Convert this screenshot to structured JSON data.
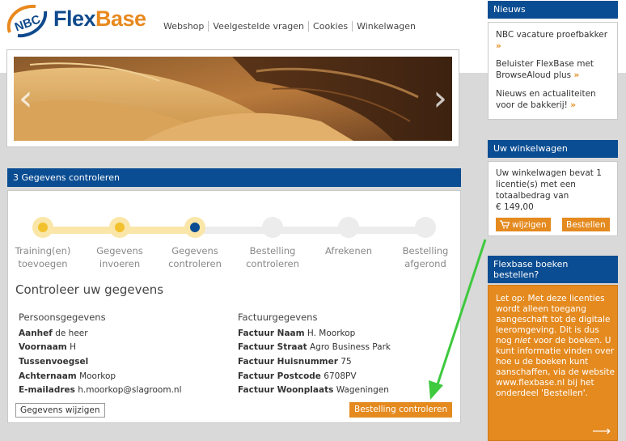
{
  "logo": {
    "badge": "NBC",
    "flex": "Flex",
    "base": "Base"
  },
  "nav": [
    "Webshop",
    "Veelgestelde vragen",
    "Cookies",
    "Winkelwagen"
  ],
  "banner": {
    "prev": "‹",
    "next": "›"
  },
  "section": {
    "title": "3 Gegevens controleren"
  },
  "steps": [
    {
      "line1": "Training(en)",
      "line2": "toevoegen",
      "state": "done"
    },
    {
      "line1": "Gegevens",
      "line2": "invoeren",
      "state": "done"
    },
    {
      "line1": "Gegevens",
      "line2": "controleren",
      "state": "current"
    },
    {
      "line1": "Bestelling",
      "line2": "controleren",
      "state": "todo"
    },
    {
      "line1": "Afrekenen",
      "line2": "",
      "state": "todo"
    },
    {
      "line1": "Bestelling",
      "line2": "afgerond",
      "state": "todo"
    }
  ],
  "check": {
    "heading": "Controleer uw gegevens",
    "personal_title": "Persoonsgegevens",
    "personal": [
      {
        "label": "Aanhef",
        "value": "de heer"
      },
      {
        "label": "Voornaam",
        "value": "H"
      },
      {
        "label": "Tussenvoegsel",
        "value": ""
      },
      {
        "label": "Achternaam",
        "value": "Moorkop"
      },
      {
        "label": "E-mailadres",
        "value": "h.moorkop@slagroom.nl"
      }
    ],
    "invoice_title": "Factuurgegevens",
    "invoice": [
      {
        "label": "Factuur Naam",
        "value": "H. Moorkop"
      },
      {
        "label": "Factuur Straat",
        "value": "Agro Business Park"
      },
      {
        "label": "Factuur Huisnummer",
        "value": "75"
      },
      {
        "label": "Factuur Postcode",
        "value": "6708PV"
      },
      {
        "label": "Factuur Woonplaats",
        "value": "Wageningen"
      }
    ],
    "edit_button": "Gegevens wijzigen",
    "continue_button": "Bestelling controleren"
  },
  "news": {
    "title": "Nieuws",
    "items": [
      {
        "text": "NBC vacature proefbakker",
        "arrow": "»"
      },
      {
        "text": "Beluister FlexBase met BrowseAloud plus",
        "arrow": "»"
      },
      {
        "text": "Nieuws en actualiteiten voor de bakkerij!",
        "arrow": "»"
      }
    ]
  },
  "cart": {
    "title": "Uw winkelwagen",
    "text": "Uw winkelwagen bevat 1 licentie(s) met een totaalbedrag van",
    "amount": "€ 149,00",
    "edit_button": "wijzigen",
    "order_button": "Bestellen"
  },
  "promo": {
    "title": "Flexbase boeken bestellen?",
    "text_before_emph": "Let op: Met deze licenties wordt alleen toegang aangeschaft tot de digitale leeromgeving. Dit is dus nog ",
    "emph": "niet",
    "text_after_emph": " voor de boeken. U kunt informatie vinden over hoe u de boeken kunt aanschaffen, via de website www.flexbase.nl bij het onderdeel 'Bestellen'.",
    "arrow": "⟶"
  },
  "colors": {
    "blue": "#0b4d92",
    "orange": "#e48a1f",
    "step_done": "#f2c12e",
    "step_current": "#0b4d92",
    "arrow": "#3ec93e"
  }
}
